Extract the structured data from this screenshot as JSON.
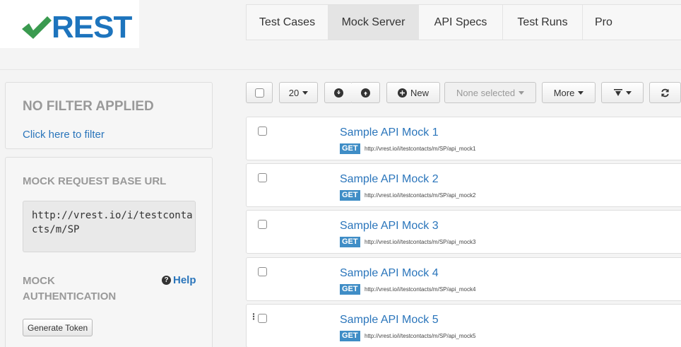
{
  "app": {
    "logo_text": "REST"
  },
  "nav": {
    "tabs": [
      {
        "label": "Test Cases"
      },
      {
        "label": "Mock Server"
      },
      {
        "label": "API Specs"
      },
      {
        "label": "Test Runs"
      },
      {
        "label": "Pro"
      }
    ],
    "active_tab": "Mock Server"
  },
  "sidebar": {
    "filter": {
      "title": "NO FILTER APPLIED",
      "link": "Click here to filter"
    },
    "mock": {
      "base_url_title": "MOCK REQUEST BASE URL",
      "base_url": "http://vrest.io/i/testcontacts/m/SP",
      "auth_title": "MOCK AUTHENTICATION",
      "help_label": "Help",
      "generate_token_label": "Generate Token"
    }
  },
  "toolbar": {
    "page_size": "20",
    "new_label": "New",
    "selection_label": "None selected",
    "more_label": "More"
  },
  "mocks": [
    {
      "name": "Sample API Mock 1",
      "method": "GET",
      "url": "http://vrest.io/i/testcontacts/m/SP/api_mock1"
    },
    {
      "name": "Sample API Mock 2",
      "method": "GET",
      "url": "http://vrest.io/i/testcontacts/m/SP/api_mock2"
    },
    {
      "name": "Sample API Mock 3",
      "method": "GET",
      "url": "http://vrest.io/i/testcontacts/m/SP/api_mock3"
    },
    {
      "name": "Sample API Mock 4",
      "method": "GET",
      "url": "http://vrest.io/i/testcontacts/m/SP/api_mock4"
    },
    {
      "name": "Sample API Mock 5",
      "method": "GET",
      "url": "http://vrest.io/i/testcontacts/m/SP/api_mock5"
    }
  ],
  "colors": {
    "brand_blue": "#1d74bd",
    "brand_green": "#3a9a4f",
    "link_blue": "#2a75bb",
    "method_badge": "#3f8dc6"
  }
}
